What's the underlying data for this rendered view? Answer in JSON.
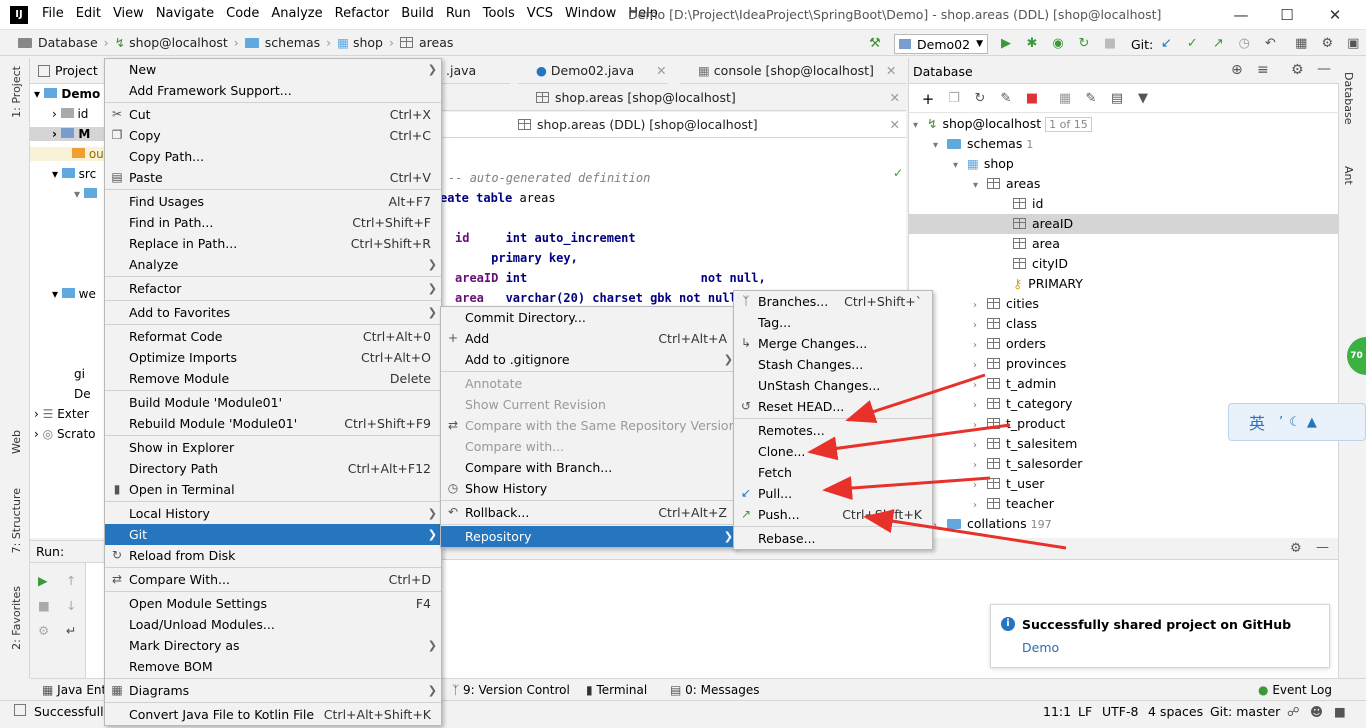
{
  "titlebar": {
    "logo": "IJ",
    "menus": [
      "File",
      "Edit",
      "View",
      "Navigate",
      "Code",
      "Analyze",
      "Refactor",
      "Build",
      "Run",
      "Tools",
      "VCS",
      "Window",
      "Help"
    ],
    "title": "Demo [D:\\Project\\IdeaProject\\SpringBoot\\Demo] - shop.areas (DDL) [shop@localhost]"
  },
  "navbar": {
    "breadcrumbs": [
      "Database",
      "shop@localhost",
      "schemas",
      "shop",
      "areas"
    ],
    "run_config": "Demo02",
    "git_label": "Git:"
  },
  "left_stripe": {
    "project": "1: Project",
    "web": "Web",
    "structure": "7: Structure",
    "favorites": "2: Favorites"
  },
  "right_stripe": {
    "database": "Database",
    "ant": "Ant"
  },
  "project_panel": {
    "title": "Project",
    "items": [
      "Demo",
      "id",
      "M",
      "ou",
      "src",
      "we",
      "gi",
      "De",
      "Exter",
      "Scrato"
    ]
  },
  "editor": {
    "tabs_row1": [
      ".java",
      "Demo02.java",
      "console [shop@localhost]"
    ],
    "tab_row2": "shop.areas [shop@localhost]",
    "tab_row3": "shop.areas (DDL) [shop@localhost]",
    "code": {
      "line1": "auto-generated definition",
      "line2_kw": "eate table",
      "line2_rest": " areas",
      "line3_col": "id",
      "line3_rest": "     int auto_increment",
      "line4": "     primary key,",
      "line5_col": "areaID",
      "line5_rest": " int                        not null,",
      "line6_col": "area",
      "line6_rest": "   varchar(20) charset gbk not null,"
    }
  },
  "db_panel": {
    "title": "Database",
    "datasource": "shop@localhost",
    "datasource_count": "1 of 15",
    "schemas_label": "schemas",
    "schemas_count": "1",
    "schema": "shop",
    "table_areas": "areas",
    "columns": [
      "id",
      "areaID",
      "area",
      "cityID",
      "PRIMARY"
    ],
    "tables": [
      "cities",
      "class",
      "orders",
      "provinces",
      "t_admin",
      "t_category",
      "t_product",
      "t_salesitem",
      "t_salesorder",
      "t_user",
      "teacher"
    ],
    "collations_label": "collations",
    "collations_count": "197"
  },
  "context_menu": [
    {
      "label": "New",
      "sub": true
    },
    {
      "label": "Add Framework Support..."
    },
    {
      "sep": true
    },
    {
      "label": "Cut",
      "shortcut": "Ctrl+X",
      "icon": "cut-icon"
    },
    {
      "label": "Copy",
      "shortcut": "Ctrl+C",
      "icon": "copy-icon"
    },
    {
      "label": "Copy Path..."
    },
    {
      "label": "Paste",
      "shortcut": "Ctrl+V",
      "icon": "paste-icon"
    },
    {
      "sep": true
    },
    {
      "label": "Find Usages",
      "shortcut": "Alt+F7"
    },
    {
      "label": "Find in Path...",
      "shortcut": "Ctrl+Shift+F"
    },
    {
      "label": "Replace in Path...",
      "shortcut": "Ctrl+Shift+R"
    },
    {
      "label": "Analyze",
      "sub": true
    },
    {
      "sep": true
    },
    {
      "label": "Refactor",
      "sub": true
    },
    {
      "sep": true
    },
    {
      "label": "Add to Favorites",
      "sub": true
    },
    {
      "sep": true
    },
    {
      "label": "Reformat Code",
      "shortcut": "Ctrl+Alt+0"
    },
    {
      "label": "Optimize Imports",
      "shortcut": "Ctrl+Alt+O"
    },
    {
      "label": "Remove Module",
      "shortcut": "Delete"
    },
    {
      "sep": true
    },
    {
      "label": "Build Module 'Module01'"
    },
    {
      "label": "Rebuild Module 'Module01'",
      "shortcut": "Ctrl+Shift+F9"
    },
    {
      "sep": true
    },
    {
      "label": "Show in Explorer"
    },
    {
      "label": "Directory Path",
      "shortcut": "Ctrl+Alt+F12"
    },
    {
      "label": "Open in Terminal",
      "icon": "terminal-icon"
    },
    {
      "sep": true
    },
    {
      "label": "Local History",
      "sub": true
    },
    {
      "label": "Git",
      "sub": true,
      "highlighted": true
    },
    {
      "label": "Reload from Disk",
      "icon": "reload-icon"
    },
    {
      "sep": true
    },
    {
      "label": "Compare With...",
      "shortcut": "Ctrl+D",
      "icon": "compare-icon"
    },
    {
      "sep": true
    },
    {
      "label": "Open Module Settings",
      "shortcut": "F4"
    },
    {
      "label": "Load/Unload Modules..."
    },
    {
      "label": "Mark Directory as",
      "sub": true
    },
    {
      "label": "Remove BOM"
    },
    {
      "sep": true
    },
    {
      "label": "Diagrams",
      "sub": true,
      "icon": "diagram-icon"
    },
    {
      "sep": true
    },
    {
      "label": "Convert Java File to Kotlin File",
      "shortcut": "Ctrl+Alt+Shift+K"
    }
  ],
  "git_menu": [
    {
      "label": "Commit Directory..."
    },
    {
      "label": "Add",
      "shortcut": "Ctrl+Alt+A",
      "icon": "plus-icon"
    },
    {
      "label": "Add to .gitignore",
      "sub": true
    },
    {
      "sep": true
    },
    {
      "label": "Annotate",
      "disabled": true
    },
    {
      "label": "Show Current Revision",
      "disabled": true
    },
    {
      "label": "Compare with the Same Repository Version",
      "disabled": true,
      "icon": "compare-icon"
    },
    {
      "label": "Compare with...",
      "disabled": true
    },
    {
      "label": "Compare with Branch..."
    },
    {
      "label": "Show History",
      "icon": "history-icon"
    },
    {
      "sep": true
    },
    {
      "label": "Rollback...",
      "shortcut": "Ctrl+Alt+Z",
      "icon": "rollback-icon"
    },
    {
      "sep": true
    },
    {
      "label": "Repository",
      "sub": true,
      "highlighted": true
    }
  ],
  "repo_menu": [
    {
      "label": "Branches...",
      "shortcut": "Ctrl+Shift+`",
      "icon": "branch-icon"
    },
    {
      "label": "Tag..."
    },
    {
      "label": "Merge Changes...",
      "icon": "merge-icon"
    },
    {
      "label": "Stash Changes..."
    },
    {
      "label": "UnStash Changes..."
    },
    {
      "label": "Reset HEAD...",
      "icon": "reset-icon"
    },
    {
      "sep": true
    },
    {
      "label": "Remotes..."
    },
    {
      "label": "Clone..."
    },
    {
      "label": "Fetch"
    },
    {
      "label": "Pull...",
      "icon": "pull-icon"
    },
    {
      "label": "Push...",
      "shortcut": "Ctrl+Shift+K",
      "icon": "push-icon"
    },
    {
      "sep": true
    },
    {
      "label": "Rebase..."
    }
  ],
  "run_panel": {
    "title": "Run:"
  },
  "bottom_tabs": [
    "Java Ente",
    "9: Version Control",
    "Terminal",
    "0: Messages"
  ],
  "event_log": "Event Log",
  "notification": {
    "title": "Successfully shared project on GitHub",
    "link": "Demo"
  },
  "statusbar": {
    "message": "Successfully",
    "position": "11:1",
    "line_sep": "LF",
    "encoding": "UTF-8",
    "indent": "4 spaces",
    "git_branch": "Git: master"
  },
  "ime": {
    "label": "英"
  },
  "badge": "70",
  "colors": {
    "highlight": "#2675bf",
    "arrow": "#e8312a"
  }
}
